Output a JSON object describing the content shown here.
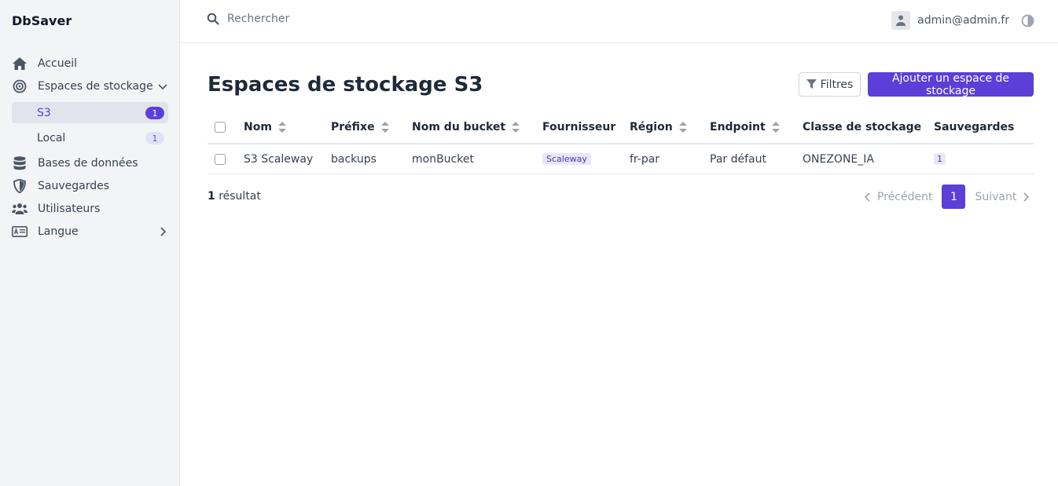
{
  "app": {
    "brand": "DbSaver"
  },
  "sidebar": {
    "items": [
      {
        "label": "Accueil",
        "icon": "home-icon"
      },
      {
        "label": "Espaces de stockage",
        "icon": "target-icon",
        "expanded": true,
        "children": [
          {
            "label": "S3",
            "count": "1",
            "active": true
          },
          {
            "label": "Local",
            "count": "1",
            "active": false
          }
        ]
      },
      {
        "label": "Bases de données",
        "icon": "database-icon"
      },
      {
        "label": "Sauvegardes",
        "icon": "shield-icon"
      },
      {
        "label": "Utilisateurs",
        "icon": "users-icon"
      },
      {
        "label": "Langue",
        "icon": "language-icon"
      }
    ]
  },
  "topbar": {
    "search_placeholder": "Rechercher",
    "user_email": "admin@admin.fr"
  },
  "main": {
    "title": "Espaces de stockage S3",
    "filter_label": "Filtres",
    "add_label": "Ajouter un espace de stockage",
    "columns": [
      "Nom",
      "Préfixe",
      "Nom du bucket",
      "Fournisseur",
      "Région",
      "Endpoint",
      "Classe de stockage",
      "Sauvegardes"
    ],
    "rows": [
      {
        "name": "S3 Scaleway",
        "prefix": "backups",
        "bucket": "monBucket",
        "provider": "Scaleway",
        "region": "fr-par",
        "endpoint": "Par défaut",
        "storage_class": "ONEZONE_IA",
        "backups": "1"
      }
    ],
    "result_count": "1",
    "result_label": "résultat",
    "pagination": {
      "prev": "Précédent",
      "page": "1",
      "next": "Suivant"
    }
  },
  "colors": {
    "accent": "#5b3fd8",
    "sidebar_bg": "#f3f4f6"
  }
}
